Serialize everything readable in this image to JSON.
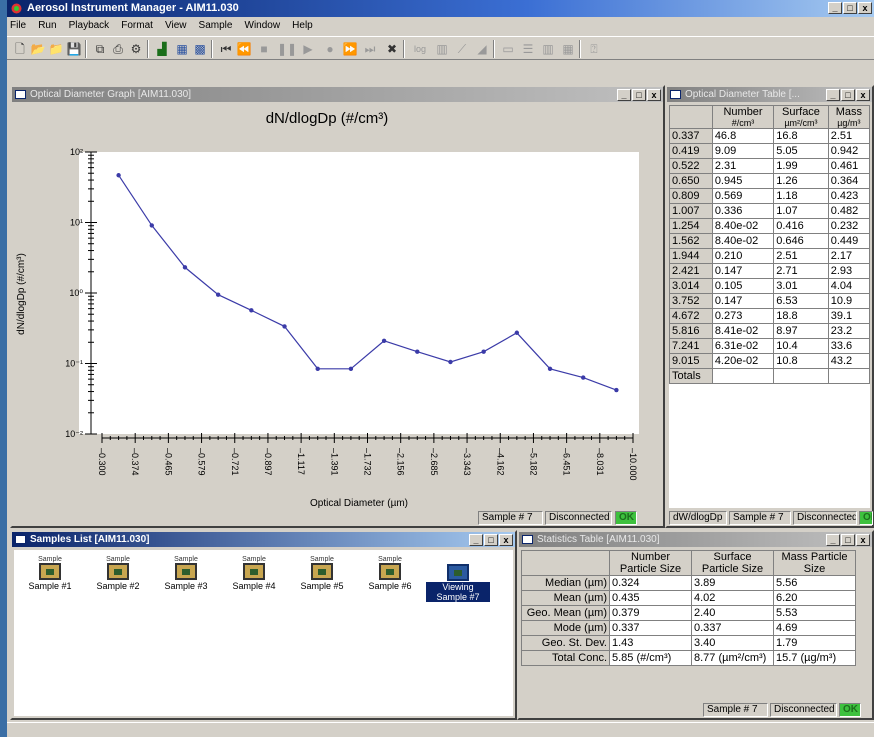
{
  "app": {
    "title": "Aerosol Instrument Manager - AIM11.030",
    "menu": [
      "File",
      "Run",
      "Playback",
      "Format",
      "View",
      "Sample",
      "Window",
      "Help"
    ],
    "log_label": "log"
  },
  "graph_window": {
    "title": "Optical Diameter Graph  [AIM11.030]",
    "status": {
      "sample": "Sample # 7",
      "connection": "Disconnected",
      "ok": "OK"
    }
  },
  "chart_data": {
    "type": "line",
    "title": "dN/dlogDp (#/cm³)",
    "xlabel": "Optical Diameter (µm)",
    "ylabel": "dN/dlogDp (#/cm³)",
    "y_scale": "log",
    "ylim": [
      0.01,
      100
    ],
    "y_ticks": [
      "10⁻²",
      "10⁻¹",
      "10⁰",
      "10¹",
      "10²"
    ],
    "x_tick_labels": [
      "0.300",
      "0.374",
      "0.465",
      "0.579",
      "0.721",
      "0.897",
      "1.117",
      "1.391",
      "1.732",
      "2.156",
      "2.685",
      "3.343",
      "4.162",
      "5.182",
      "6.451",
      "8.031",
      "10.000"
    ],
    "grid": false,
    "series": [
      {
        "values": [
          46.8,
          9.09,
          2.31,
          0.945,
          0.569,
          0.336,
          0.084,
          0.084,
          0.21,
          0.147,
          0.105,
          0.147,
          0.273,
          0.0841,
          0.0631,
          0.042
        ]
      }
    ],
    "color": "#3b3ba8"
  },
  "od_table": {
    "title": "Optical Diameter Table  [...",
    "headers": [
      [
        "",
        ""
      ],
      [
        "Number",
        "#/cm³"
      ],
      [
        "Surface",
        "µm²/cm³"
      ],
      [
        "Mass",
        "µg/m³"
      ]
    ],
    "rows": [
      [
        "0.337",
        "46.8",
        "16.8",
        "2.51"
      ],
      [
        "0.419",
        "9.09",
        "5.05",
        "0.942"
      ],
      [
        "0.522",
        "2.31",
        "1.99",
        "0.461"
      ],
      [
        "0.650",
        "0.945",
        "1.26",
        "0.364"
      ],
      [
        "0.809",
        "0.569",
        "1.18",
        "0.423"
      ],
      [
        "1.007",
        "0.336",
        "1.07",
        "0.482"
      ],
      [
        "1.254",
        "8.40e-02",
        "0.416",
        "0.232"
      ],
      [
        "1.562",
        "8.40e-02",
        "0.646",
        "0.449"
      ],
      [
        "1.944",
        "0.210",
        "2.51",
        "2.17"
      ],
      [
        "2.421",
        "0.147",
        "2.71",
        "2.93"
      ],
      [
        "3.014",
        "0.105",
        "3.01",
        "4.04"
      ],
      [
        "3.752",
        "0.147",
        "6.53",
        "10.9"
      ],
      [
        "4.672",
        "0.273",
        "18.8",
        "39.1"
      ],
      [
        "5.816",
        "8.41e-02",
        "8.97",
        "23.2"
      ],
      [
        "7.241",
        "6.31e-02",
        "10.4",
        "33.6"
      ],
      [
        "9.015",
        "4.20e-02",
        "10.8",
        "43.2"
      ],
      [
        "Totals",
        "",
        "",
        ""
      ]
    ],
    "status": {
      "mode": "dW/dlogDp",
      "sample": "Sample # 7",
      "connection": "Disconnected",
      "ok": "OK"
    }
  },
  "samples_list": {
    "title": "Samples List  [AIM11.030]",
    "items": [
      {
        "top": "Sample",
        "label": "Sample #1"
      },
      {
        "top": "Sample",
        "label": "Sample #2"
      },
      {
        "top": "Sample",
        "label": "Sample #3"
      },
      {
        "top": "Sample",
        "label": "Sample #4"
      },
      {
        "top": "Sample",
        "label": "Sample #5"
      },
      {
        "top": "Sample",
        "label": "Sample #6"
      },
      {
        "top": "",
        "label": "Viewing Sample #7"
      }
    ]
  },
  "stats_table": {
    "title": "Statistics Table  [AIM11.030]",
    "headers": [
      "",
      "Number Particle Size",
      "Surface Particle Size",
      "Mass Particle Size"
    ],
    "rows": [
      [
        "Median (µm)",
        "0.324",
        "3.89",
        "5.56"
      ],
      [
        "Mean (µm)",
        "0.435",
        "4.02",
        "6.20"
      ],
      [
        "Geo. Mean (µm)",
        "0.379",
        "2.40",
        "5.53"
      ],
      [
        "Mode (µm)",
        "0.337",
        "0.337",
        "4.69"
      ],
      [
        "Geo. St. Dev.",
        "1.43",
        "3.40",
        "1.79"
      ],
      [
        "Total Conc.",
        "5.85 (#/cm³)",
        "8.77 (µm²/cm³)",
        "15.7 (µg/m³)"
      ]
    ],
    "status": {
      "sample": "Sample # 7",
      "connection": "Disconnected",
      "ok": "OK"
    }
  },
  "controls": {
    "minimize": "_",
    "restore": "□",
    "close": "x"
  }
}
